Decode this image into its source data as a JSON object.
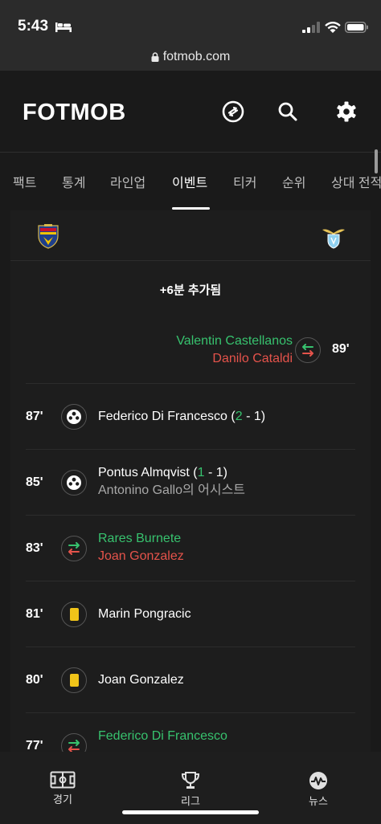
{
  "status": {
    "time": "5:43"
  },
  "browser": {
    "url": "fotmob.com"
  },
  "header": {
    "logo": "FOTMOB",
    "icons": [
      "transfer-icon",
      "search-icon",
      "gear-icon"
    ]
  },
  "tabs": [
    {
      "label": "팩트"
    },
    {
      "label": "통계"
    },
    {
      "label": "라인업"
    },
    {
      "label": "이벤트",
      "active": true
    },
    {
      "label": "티커"
    },
    {
      "label": "순위"
    },
    {
      "label": "상대 전적"
    }
  ],
  "match": {
    "home_crest": "lecce-crest",
    "away_crest": "lazio-crest",
    "added_time": "+6분 추가됨"
  },
  "events": [
    {
      "minute": "89'",
      "type": "substitution",
      "side": "away",
      "in": "Valentin Castellanos",
      "out": "Danilo Cataldi"
    },
    {
      "minute": "87'",
      "type": "goal",
      "side": "home",
      "player": "Federico Di Francesco",
      "score_open": " (",
      "score_home": "2",
      "score_sep": " - 1)"
    },
    {
      "minute": "85'",
      "type": "goal",
      "side": "home",
      "player": "Pontus Almqvist",
      "score_open": " (",
      "score_home": "1",
      "score_sep": " - 1)",
      "assist": "Antonino Gallo의 어시스트"
    },
    {
      "minute": "83'",
      "type": "substitution",
      "side": "home",
      "in": "Rares Burnete",
      "out": "Joan Gonzalez"
    },
    {
      "minute": "81'",
      "type": "yellow-card",
      "side": "home",
      "player": "Marin Pongracic"
    },
    {
      "minute": "80'",
      "type": "yellow-card",
      "side": "home",
      "player": "Joan Gonzalez"
    },
    {
      "minute": "77'",
      "type": "substitution",
      "side": "home",
      "in": "Federico Di Francesco"
    }
  ],
  "bottom_nav": [
    {
      "label": "경기",
      "icon": "pitch-icon"
    },
    {
      "label": "리그",
      "icon": "trophy-icon"
    },
    {
      "label": "뉴스",
      "icon": "news-icon"
    }
  ],
  "colors": {
    "background": "#1a1a1a",
    "card": "#1d1d1d",
    "green": "#37c26e",
    "red": "#e5534b",
    "yellow": "#f0c419"
  }
}
